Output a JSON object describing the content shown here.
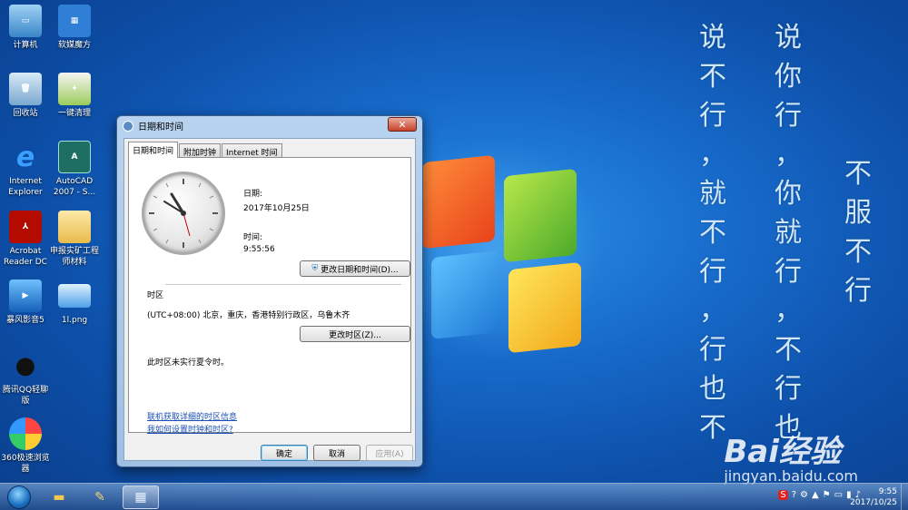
{
  "desktop": {
    "icons": [
      {
        "label": "计算机"
      },
      {
        "label": "软媒魔方"
      },
      {
        "label": "回收站"
      },
      {
        "label": "一键清理"
      },
      {
        "label": "Internet Explorer"
      },
      {
        "label": "AutoCAD 2007 - S..."
      },
      {
        "label": "Acrobat Reader DC"
      },
      {
        "label": "申报实矿工程师材料"
      },
      {
        "label": "暴风影音5"
      },
      {
        "label": "1l.png"
      },
      {
        "label": "腾讯QQ轻聊版"
      },
      {
        "label": "360极速浏览器"
      }
    ],
    "calligraphy": {
      "col1": [
        "说",
        "不",
        "行",
        "，",
        "就",
        "不",
        "行",
        "，",
        "行",
        "也",
        "不"
      ],
      "col2": [
        "说",
        "你",
        "行",
        "，",
        "你",
        "就",
        "行",
        "，",
        "不",
        "行",
        "也"
      ],
      "col3": [
        "不",
        "服",
        "不",
        "行"
      ]
    },
    "watermark": {
      "brand": "Bai经验",
      "url": "jingyan.baidu.com"
    }
  },
  "dialog": {
    "title": "日期和时间",
    "close_label": "✕",
    "tabs": [
      {
        "label": "日期和时间"
      },
      {
        "label": "附加时钟"
      },
      {
        "label": "Internet 时间"
      }
    ],
    "date_label": "日期:",
    "date_value": "2017年10月25日",
    "time_label": "时间:",
    "time_value": "9:55:56",
    "change_datetime_button": "更改日期和时间(D)...",
    "timezone_header": "时区",
    "timezone_value": "(UTC+08:00) 北京，重庆，香港特别行政区，乌鲁木齐",
    "change_timezone_button": "更改时区(Z)...",
    "dst_note": "此时区未实行夏令时。",
    "link_timezone_info": "联机获取详细的时区信息",
    "link_how_set": "我如何设置时钟和时区?",
    "ok_button": "确定",
    "cancel_button": "取消",
    "apply_button": "应用(A)"
  },
  "taskbar": {
    "clock_time": "9:55",
    "clock_date": "2017/10/25"
  }
}
